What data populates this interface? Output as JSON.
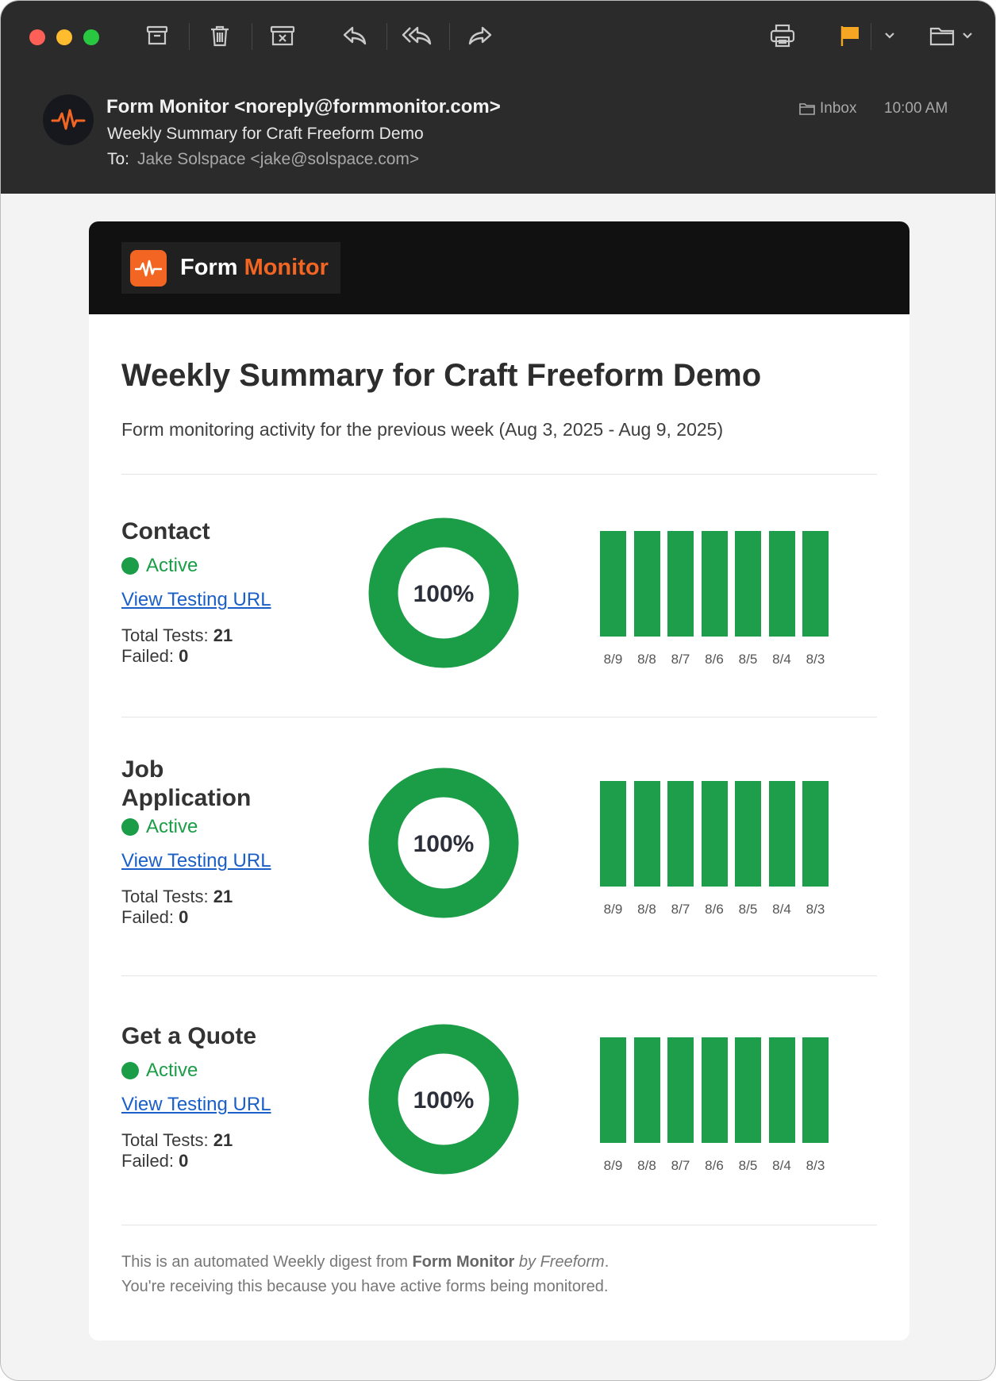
{
  "toolbar": {
    "icons": [
      "archive-icon",
      "trash-icon",
      "junk-icon",
      "reply-icon",
      "reply-all-icon",
      "forward-icon",
      "print-icon",
      "flag-icon",
      "chevron-down-icon",
      "move-folder-icon",
      "chevron-down-icon"
    ],
    "flag_color": "#f5a623"
  },
  "message": {
    "from": "Form Monitor <noreply@formmonitor.com>",
    "subject": "Weekly Summary for Craft Freeform Demo",
    "to_label": "To:",
    "to": "Jake Solspace <jake@solspace.com>",
    "mailbox": "Inbox",
    "time": "10:00 AM"
  },
  "email": {
    "brand": {
      "word1": "Form",
      "word2": "Monitor"
    },
    "title": "Weekly Summary for Craft Freeform Demo",
    "subtitle": "Form monitoring activity for the previous week (Aug 3, 2025 - Aug 9, 2025)",
    "colors": {
      "accent": "#f26522",
      "success": "#1b9d47",
      "link": "#1a5fc8"
    },
    "forms": [
      {
        "name": "Contact",
        "status": "Active",
        "link": "View Testing URL",
        "total_label": "Total Tests:",
        "total": "21",
        "failed_label": "Failed:",
        "failed": "0",
        "percent_label": "100%",
        "percent": 100,
        "days": [
          "8/9",
          "8/8",
          "8/7",
          "8/6",
          "8/5",
          "8/4",
          "8/3"
        ],
        "day_results": [
          [
            1,
            1,
            1
          ],
          [
            1,
            1,
            1
          ],
          [
            1,
            1,
            1
          ],
          [
            1,
            1,
            1
          ],
          [
            1,
            1,
            1
          ],
          [
            1,
            1,
            1
          ],
          [
            1,
            1,
            1
          ]
        ]
      },
      {
        "name": "Job Application",
        "status": "Active",
        "link": "View Testing URL",
        "total_label": "Total Tests:",
        "total": "21",
        "failed_label": "Failed:",
        "failed": "0",
        "percent_label": "100%",
        "percent": 100,
        "days": [
          "8/9",
          "8/8",
          "8/7",
          "8/6",
          "8/5",
          "8/4",
          "8/3"
        ],
        "day_results": [
          [
            1,
            1,
            1
          ],
          [
            1,
            1,
            1
          ],
          [
            1,
            1,
            1
          ],
          [
            1,
            1,
            1
          ],
          [
            1,
            1,
            1
          ],
          [
            1,
            1,
            1
          ],
          [
            1,
            1,
            1
          ]
        ]
      },
      {
        "name": "Get a Quote",
        "status": "Active",
        "link": "View Testing URL",
        "total_label": "Total Tests:",
        "total": "21",
        "failed_label": "Failed:",
        "failed": "0",
        "percent_label": "100%",
        "percent": 100,
        "days": [
          "8/9",
          "8/8",
          "8/7",
          "8/6",
          "8/5",
          "8/4",
          "8/3"
        ],
        "day_results": [
          [
            1,
            1,
            1
          ],
          [
            1,
            1,
            1
          ],
          [
            1,
            1,
            1
          ],
          [
            1,
            1,
            1
          ],
          [
            1,
            1,
            1
          ],
          [
            1,
            1,
            1
          ],
          [
            1,
            1,
            1
          ]
        ]
      }
    ],
    "footer": {
      "line1_pre": "This is an automated Weekly digest from ",
      "line1_brand": "Form Monitor",
      "line1_by": "by Freeform",
      "line1_end": ".",
      "line2": "You're receiving this because you have active forms being monitored."
    }
  }
}
